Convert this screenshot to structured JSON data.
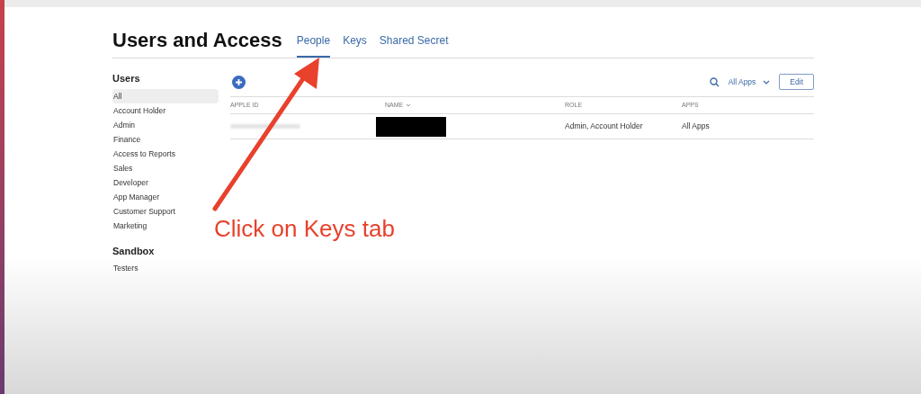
{
  "page_title": "Users and Access",
  "tabs": [
    {
      "label": "People",
      "selected": true
    },
    {
      "label": "Keys",
      "selected": false
    },
    {
      "label": "Shared Secret",
      "selected": false
    }
  ],
  "sidebar": {
    "sections": [
      {
        "title": "Users",
        "items": [
          {
            "label": "All",
            "selected": true
          },
          {
            "label": "Account Holder",
            "selected": false
          },
          {
            "label": "Admin",
            "selected": false
          },
          {
            "label": "Finance",
            "selected": false
          },
          {
            "label": "Access to Reports",
            "selected": false
          },
          {
            "label": "Sales",
            "selected": false
          },
          {
            "label": "Developer",
            "selected": false
          },
          {
            "label": "App Manager",
            "selected": false
          },
          {
            "label": "Customer Support",
            "selected": false
          },
          {
            "label": "Marketing",
            "selected": false
          }
        ]
      },
      {
        "title": "Sandbox",
        "items": [
          {
            "label": "Testers",
            "selected": false
          }
        ]
      }
    ]
  },
  "toolbar": {
    "filter": "All Apps",
    "edit_button": "Edit"
  },
  "table": {
    "columns": [
      "APPLE ID",
      "NAME",
      "ROLE",
      "APPS"
    ],
    "rows": [
      {
        "role": "Admin, Account Holder",
        "apps": "All Apps"
      }
    ]
  },
  "annotation": {
    "text": "Click on Keys tab"
  }
}
